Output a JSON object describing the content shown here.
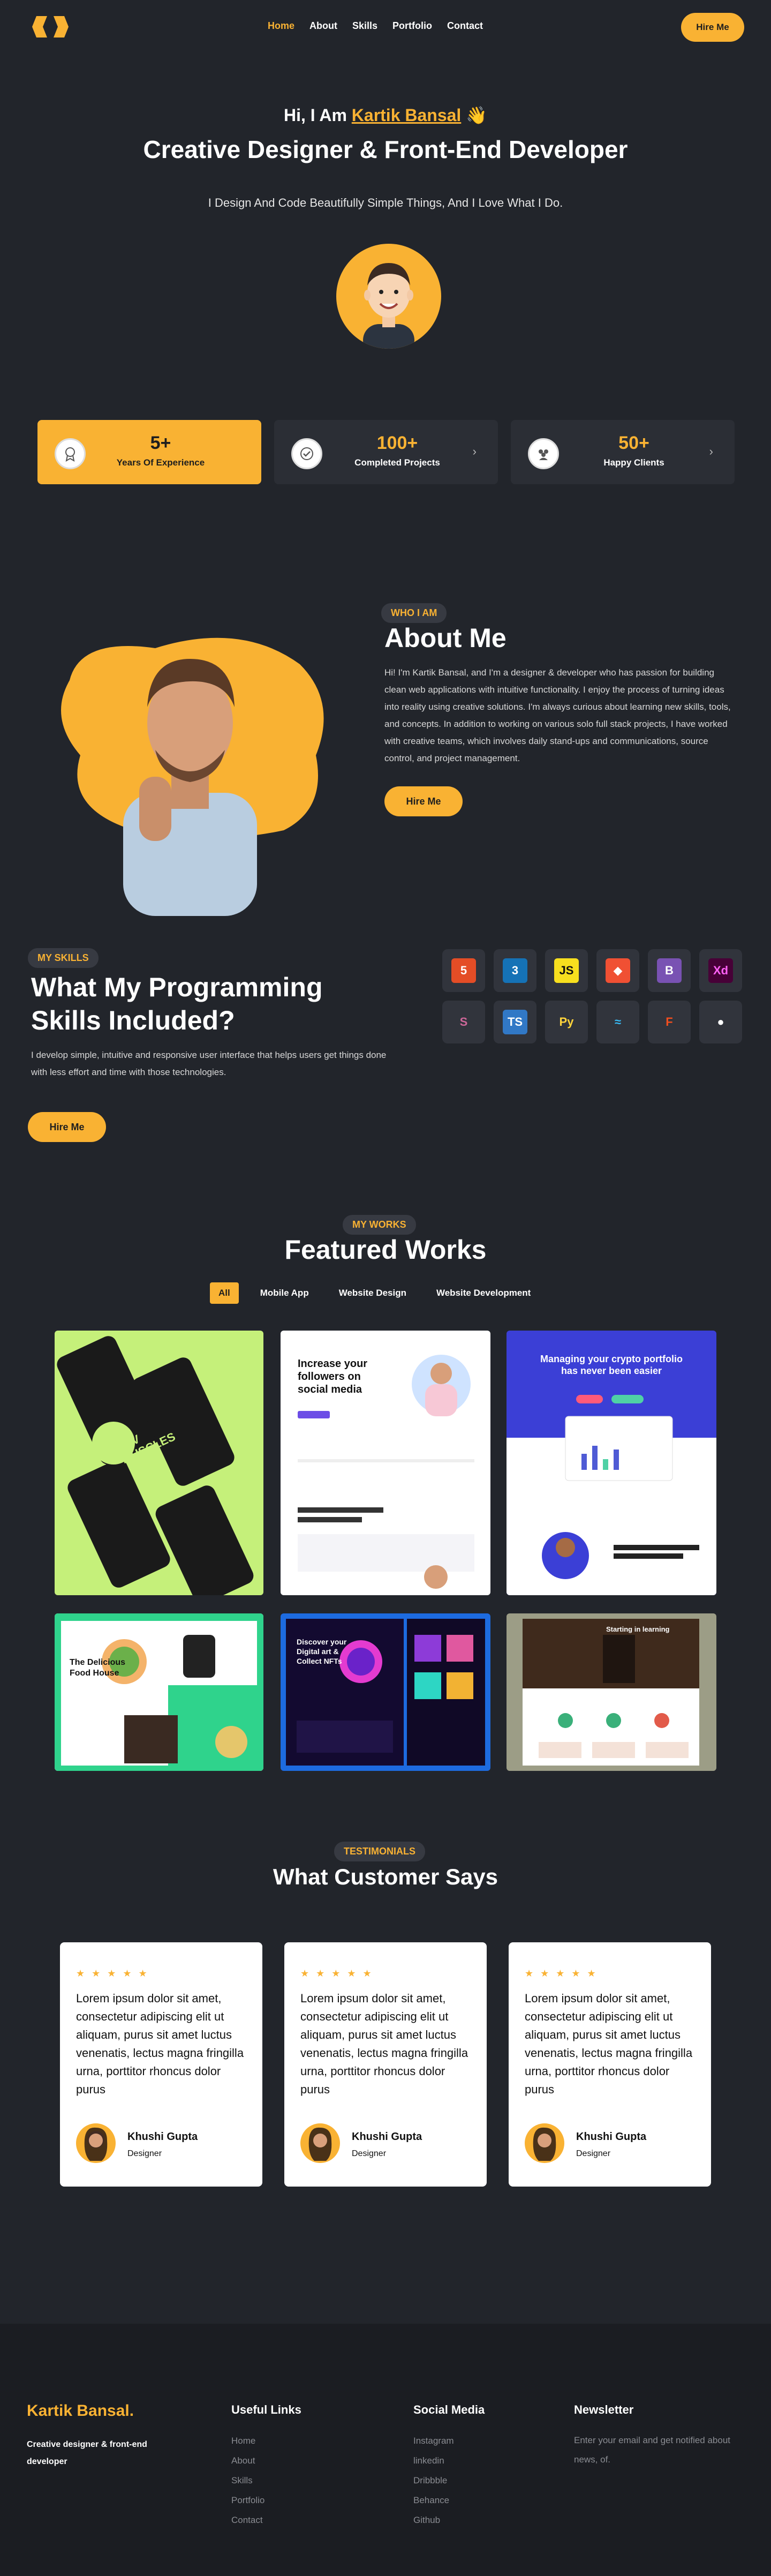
{
  "nav": {
    "links": [
      "Home",
      "About",
      "Skills",
      "Portfolio",
      "Contact"
    ],
    "active": "Home",
    "hire_label": "Hire Me"
  },
  "hero": {
    "greeting": "Hi, I Am",
    "name": "Kartik Bansal",
    "wave": "👋",
    "title": "Creative Designer & Front-End Developer",
    "subtitle": "I Design And Code Beautifully Simple Things, And I Love What I Do."
  },
  "stats": [
    {
      "value": "5+",
      "label": "Years Of Experience",
      "icon": "award-icon"
    },
    {
      "value": "100+",
      "label": "Completed Projects",
      "icon": "check-circle-icon"
    },
    {
      "value": "50+",
      "label": "Happy Clients",
      "icon": "users-icon"
    }
  ],
  "about": {
    "pill": "WHO I AM",
    "title": "About Me",
    "text": "Hi! I'm Kartik Bansal, and I'm a designer & developer who has passion for building clean web applications with intuitive functionality. I enjoy the process of turning ideas into reality using creative solutions. I'm always curious about learning new skills, tools, and concepts. In addition to working on various solo full stack projects, I have worked with creative teams, which involves daily stand-ups and communications, source control, and project management.",
    "button": "Hire Me"
  },
  "skills": {
    "pill": "MY SKILLS",
    "title": "What My Programming Skills Included?",
    "text": "I develop simple, intuitive and responsive user interface that helps users get things done with less effort and time with those technologies.",
    "button": "Hire Me",
    "icons": [
      {
        "name": "html5-icon",
        "glyph": "5",
        "bg": "#e44d26",
        "fg": "#ffffff"
      },
      {
        "name": "css3-icon",
        "glyph": "3",
        "bg": "#1572b6",
        "fg": "#ffffff"
      },
      {
        "name": "javascript-icon",
        "glyph": "JS",
        "bg": "#f7df1e",
        "fg": "#111111"
      },
      {
        "name": "git-icon",
        "glyph": "◆",
        "bg": "#f05033",
        "fg": "#ffffff"
      },
      {
        "name": "bootstrap-icon",
        "glyph": "B",
        "bg": "#7952b3",
        "fg": "#ffffff"
      },
      {
        "name": "adobe-xd-icon",
        "glyph": "Xd",
        "bg": "#470137",
        "fg": "#ff61f6"
      },
      {
        "name": "sass-icon",
        "glyph": "S",
        "bg": "#31343c",
        "fg": "#cd6799"
      },
      {
        "name": "typescript-icon",
        "glyph": "TS",
        "bg": "#3178c6",
        "fg": "#ffffff"
      },
      {
        "name": "python-icon",
        "glyph": "Py",
        "bg": "#31343c",
        "fg": "#ffd43b"
      },
      {
        "name": "tailwind-icon",
        "glyph": "≈",
        "bg": "#31343c",
        "fg": "#38bdf8"
      },
      {
        "name": "figma-icon",
        "glyph": "F",
        "bg": "#31343c",
        "fg": "#f24e1e"
      },
      {
        "name": "github-icon",
        "glyph": "●",
        "bg": "#31343c",
        "fg": "#ffffff"
      }
    ]
  },
  "works": {
    "pill": "MY WORKS",
    "title": "Featured Works",
    "filters": [
      "All",
      "Mobile App",
      "Website Design",
      "Website Development"
    ],
    "active_filter": "All",
    "items": [
      {
        "name": "work-dev-muscles",
        "bg": "#c5f07a",
        "caption": "DEV MUSCLES"
      },
      {
        "name": "work-social-followers",
        "bg": "#ffffff",
        "caption": "Increase your followers on social media"
      },
      {
        "name": "work-crypto-portfolio",
        "bg": "#3b3fd6",
        "caption": "Managing your crypto portfolio has never been easier"
      },
      {
        "name": "work-food-house",
        "bg": "#ffffff",
        "caption": "The Delicious Food House"
      },
      {
        "name": "work-nft",
        "bg": "#1c1140",
        "caption": "Discover your Digital art & Collect NFTs"
      },
      {
        "name": "work-library",
        "bg": "#55554a",
        "caption": "Starting in learning"
      }
    ]
  },
  "testimonials": {
    "pill": "TESTIMONIALS",
    "title": "What Customer Says",
    "stars": "★ ★ ★ ★ ★",
    "items": [
      {
        "quote": "Lorem ipsum dolor sit amet, consectetur adipiscing elit ut aliquam, purus sit amet luctus venenatis, lectus magna fringilla urna, porttitor rhoncus dolor purus",
        "name": "Khushi Gupta",
        "role": "Designer"
      },
      {
        "quote": "Lorem ipsum dolor sit amet, consectetur adipiscing elit ut aliquam, purus sit amet luctus venenatis, lectus magna fringilla urna, porttitor rhoncus dolor purus",
        "name": "Khushi Gupta",
        "role": "Designer"
      },
      {
        "quote": "Lorem ipsum dolor sit amet, consectetur adipiscing elit ut aliquam, purus sit amet luctus venenatis, lectus magna fringilla urna, porttitor rhoncus dolor purus",
        "name": "Khushi Gupta",
        "role": "Designer"
      }
    ]
  },
  "footer": {
    "brand": "Kartik Bansal.",
    "tagline": "Creative designer & front-end developer",
    "useful_links": {
      "title": "Useful Links",
      "items": [
        "Home",
        "About",
        "Skills",
        "Portfolio",
        "Contact"
      ]
    },
    "social": {
      "title": "Social Media",
      "items": [
        "Instagram",
        "linkedin",
        "Dribbble",
        "Behance",
        "Github"
      ]
    },
    "newsletter": {
      "title": "Newsletter",
      "text": "Enter your email and get notified about news, of."
    }
  },
  "colors": {
    "accent": "#f9b233",
    "background": "#22252b",
    "card": "#2b2e35",
    "footer": "#1b1d22"
  }
}
